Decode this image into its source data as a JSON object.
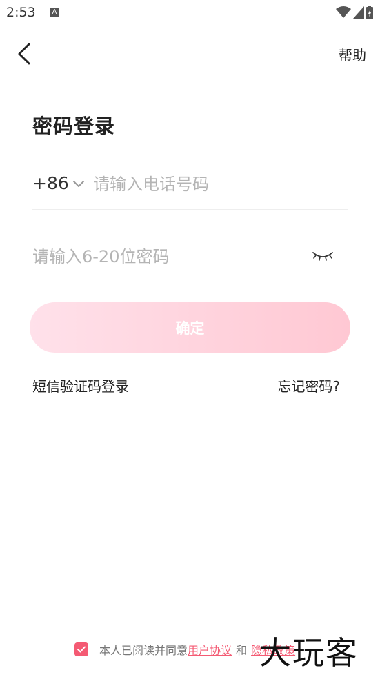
{
  "status_bar": {
    "time": "2:53",
    "notification_icon": "A"
  },
  "header": {
    "back_icon": "chevron-left-icon",
    "help_label": "帮助"
  },
  "page": {
    "title": "密码登录"
  },
  "phone": {
    "country_code": "+86",
    "placeholder": "请输入电话号码",
    "value": ""
  },
  "password": {
    "placeholder": "请输入6-20位密码",
    "value": ""
  },
  "confirm_label": "确定",
  "links": {
    "sms_login": "短信验证码登录",
    "forgot_password": "忘记密码?"
  },
  "agreement": {
    "checked": true,
    "prefix": "本人已阅读并同意",
    "user_agreement": "用户协议",
    "and": "和",
    "privacy_policy": "隐私政策"
  },
  "watermark": "大玩客",
  "colors": {
    "accent": "#f45a73",
    "button_gradient_start": "#ffe1ea",
    "button_gradient_end": "#ffc8d3"
  }
}
